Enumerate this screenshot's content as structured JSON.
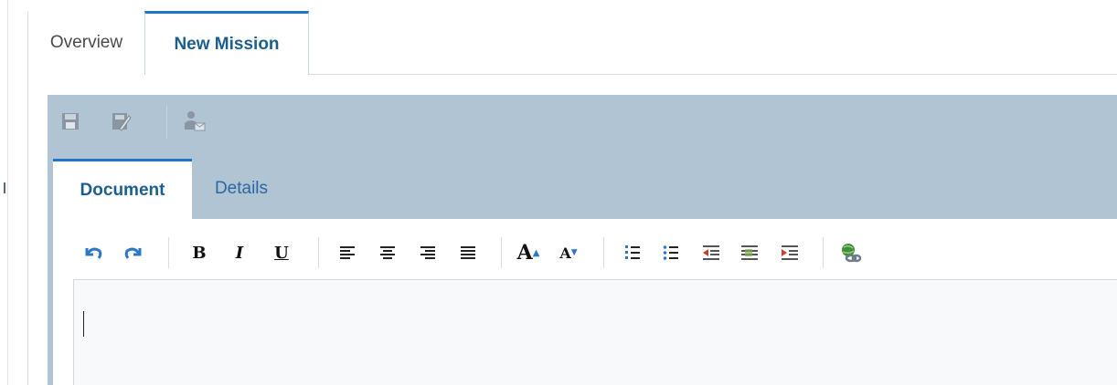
{
  "tabs": [
    {
      "label": "Overview"
    },
    {
      "label": "New Mission"
    }
  ],
  "toolbar": {
    "icons": [
      "save-icon",
      "save-and-close-icon",
      "assign-user-icon"
    ]
  },
  "inner_tabs": [
    {
      "label": "Document"
    },
    {
      "label": "Details"
    }
  ],
  "editor_toolbar": {
    "undo": "undo-icon",
    "redo": "redo-icon",
    "bold": "B",
    "italic": "I",
    "underline": "U",
    "font_larger": "A",
    "font_smaller": "A"
  },
  "editor": {
    "content": ""
  },
  "colors": {
    "accent": "#1d76c9",
    "panel": "#b0c4d4",
    "tab_text": "#1c5f8c"
  }
}
